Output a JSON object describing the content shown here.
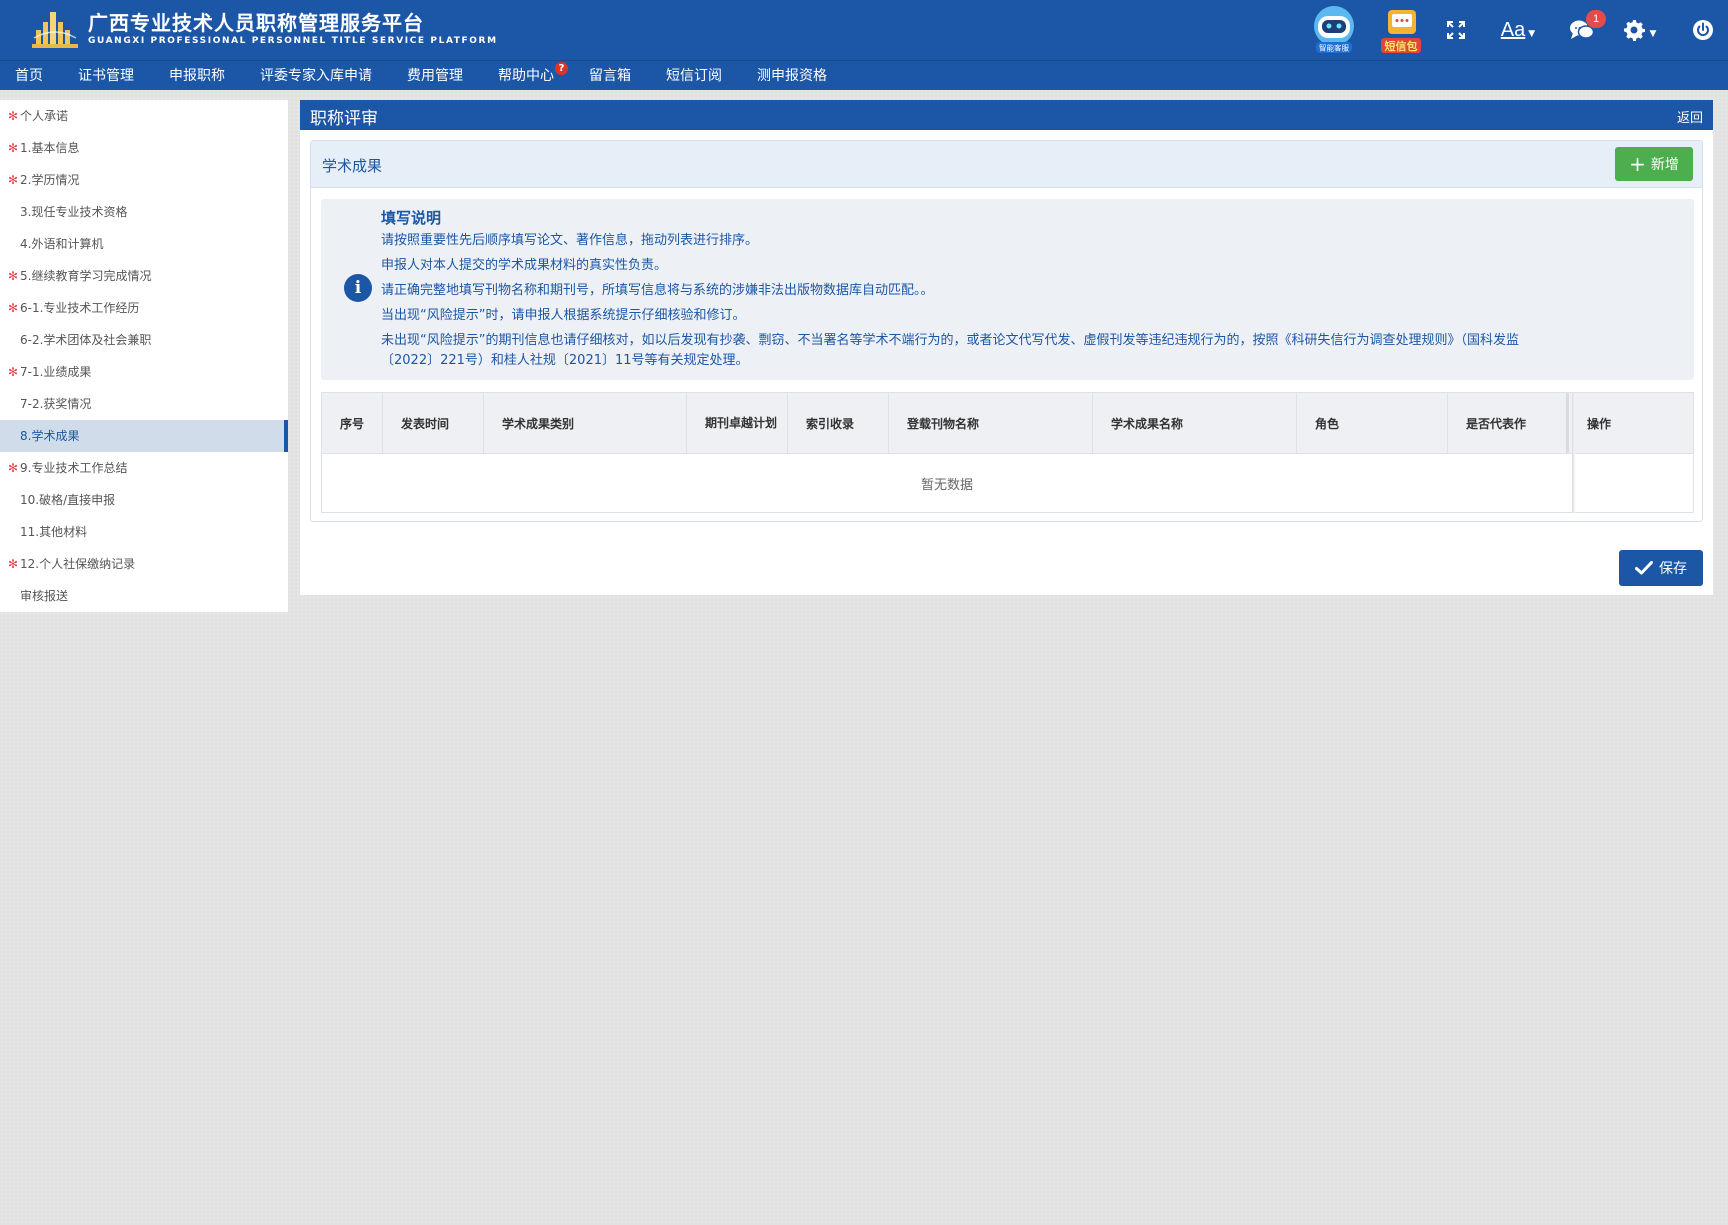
{
  "header": {
    "title": "广西专业技术人员职称管理服务平台",
    "subtitle": "GUANGXI PROFESSIONAL PERSONNEL TITLE SERVICE PLATFORM",
    "robot_label": "智能客服",
    "sms_label": "短信包",
    "font_label": "Aa",
    "message_count": "1",
    "brand_color": "#1c56a7"
  },
  "nav": {
    "items": [
      "首页",
      "证书管理",
      "申报职称",
      "评委专家入库申请",
      "费用管理",
      "帮助中心",
      "留言箱",
      "短信订阅",
      "测申报资格"
    ],
    "help_badge": "?"
  },
  "sidebar": {
    "items": [
      {
        "label": "个人承诺",
        "required": true
      },
      {
        "label": "1.基本信息",
        "required": true
      },
      {
        "label": "2.学历情况",
        "required": true
      },
      {
        "label": "3.现任专业技术资格",
        "required": false
      },
      {
        "label": "4.外语和计算机",
        "required": false
      },
      {
        "label": "5.继续教育学习完成情况",
        "required": true
      },
      {
        "label": "6-1.专业技术工作经历",
        "required": true
      },
      {
        "label": "6-2.学术团体及社会兼职",
        "required": false
      },
      {
        "label": "7-1.业绩成果",
        "required": true
      },
      {
        "label": "7-2.获奖情况",
        "required": false
      },
      {
        "label": "8.学术成果",
        "required": false,
        "active": true
      },
      {
        "label": "9.专业技术工作总结",
        "required": true
      },
      {
        "label": "10.破格/直接申报",
        "required": false
      },
      {
        "label": "11.其他材料",
        "required": false
      },
      {
        "label": "12.个人社保缴纳记录",
        "required": true
      },
      {
        "label": "审核报送",
        "required": false
      }
    ],
    "required_mark": "✻"
  },
  "main": {
    "title": "职称评审",
    "back_label": "返回",
    "card_title": "学术成果",
    "add_label": "新增",
    "notice": {
      "title": "填写说明",
      "lines": [
        "请按照重要性先后顺序填写论文、著作信息，拖动列表进行排序。",
        "申报人对本人提交的学术成果材料的真实性负责。",
        "请正确完整地填写刊物名称和期刊号，所填写信息将与系统的涉嫌非法出版物数据库自动匹配。。",
        "当出现“风险提示”时，请申报人根据系统提示仔细核验和修订。",
        "未出现“风险提示”的期刊信息也请仔细核对，如以后发现有抄袭、剽窃、不当署名等学术不端行为的，或者论文代写代发、虚假刊发等违纪违规行为的，按照《科研失信行为调查处理规则》（国科发监",
        "〔2022〕221号）和桂人社规〔2021〕11号等有关规定处理。"
      ]
    },
    "table": {
      "columns": [
        "序号",
        "发表时间",
        "学术成果类别",
        "期刊卓越计划",
        "索引收录",
        "登载刊物名称",
        "学术成果名称",
        "角色",
        "是否代表作",
        "操作"
      ],
      "empty_text": "暂无数据"
    },
    "save_label": "保存"
  }
}
